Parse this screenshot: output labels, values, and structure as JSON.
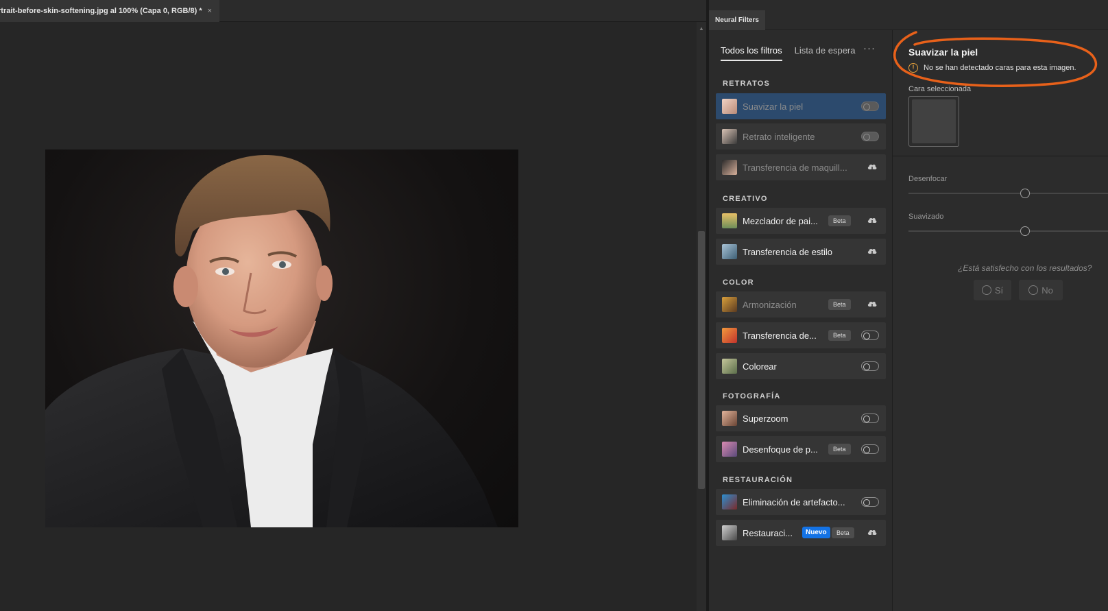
{
  "document": {
    "tab_title": "rtrait-before-skin-softening.jpg al 100% (Capa 0, RGB/8) *",
    "close_glyph": "×"
  },
  "panel": {
    "tab_label": "Neural Filters",
    "tabs": [
      {
        "label": "Todos los filtros",
        "active": true
      },
      {
        "label": "Lista de espera",
        "active": false
      }
    ],
    "more_glyph": "···",
    "sections": {
      "retratos": "RETRATOS",
      "creativo": "CREATIVO",
      "color": "COLOR",
      "fotografia": "FOTOGRAFÍA",
      "restauracion": "RESTAURACIÓN"
    },
    "filters": [
      {
        "label": "Suavizar la piel",
        "state": "toggle",
        "selected": true,
        "disabled": true,
        "icon": "face-thumbnail"
      },
      {
        "label": "Retrato inteligente",
        "state": "toggle",
        "disabled": true,
        "icon": "portrait-thumbnail"
      },
      {
        "label": "Transferencia de maquill...",
        "state": "cloud",
        "disabled": true,
        "icon": "makeup-thumbnail"
      },
      {
        "label": "Mezclador de pai...",
        "badge": "Beta",
        "state": "cloud",
        "icon": "landscape-thumbnail"
      },
      {
        "label": "Transferencia de estilo",
        "state": "cloud",
        "icon": "style-thumbnail"
      },
      {
        "label": "Armonización",
        "badge": "Beta",
        "state": "cloud",
        "disabled": true,
        "icon": "harmony-thumbnail"
      },
      {
        "label": "Transferencia de...",
        "badge": "Beta",
        "state": "toggle",
        "icon": "color-transfer-thumbnail"
      },
      {
        "label": "Colorear",
        "state": "toggle",
        "icon": "colorize-thumbnail"
      },
      {
        "label": "Superzoom",
        "state": "toggle",
        "icon": "superzoom-thumbnail"
      },
      {
        "label": "Desenfoque de p...",
        "badge": "Beta",
        "state": "toggle",
        "icon": "depth-blur-thumbnail"
      },
      {
        "label": "Eliminación de artefacto...",
        "state": "toggle",
        "icon": "jpeg-artifacts-thumbnail"
      },
      {
        "label": "Restauraci...",
        "badge_new": "Nuevo",
        "badge": "Beta",
        "state": "cloud",
        "icon": "photo-restore-thumbnail"
      }
    ]
  },
  "detail": {
    "title": "Suavizar la piel",
    "warning": "No se han detectado caras para esta imagen.",
    "face_label": "Cara seleccionada",
    "sliders": [
      {
        "label": "Desenfocar",
        "value": 0.55
      },
      {
        "label": "Suavizado",
        "value": 0.55
      }
    ],
    "question": "¿Está satisfecho con los resultados?",
    "yes_label": "Sí",
    "no_label": "No"
  },
  "colors": {
    "selected_row": "#2c4a6d",
    "annotation": "#e8611a",
    "warning": "#e8a33d",
    "new_badge": "#1473e6"
  }
}
